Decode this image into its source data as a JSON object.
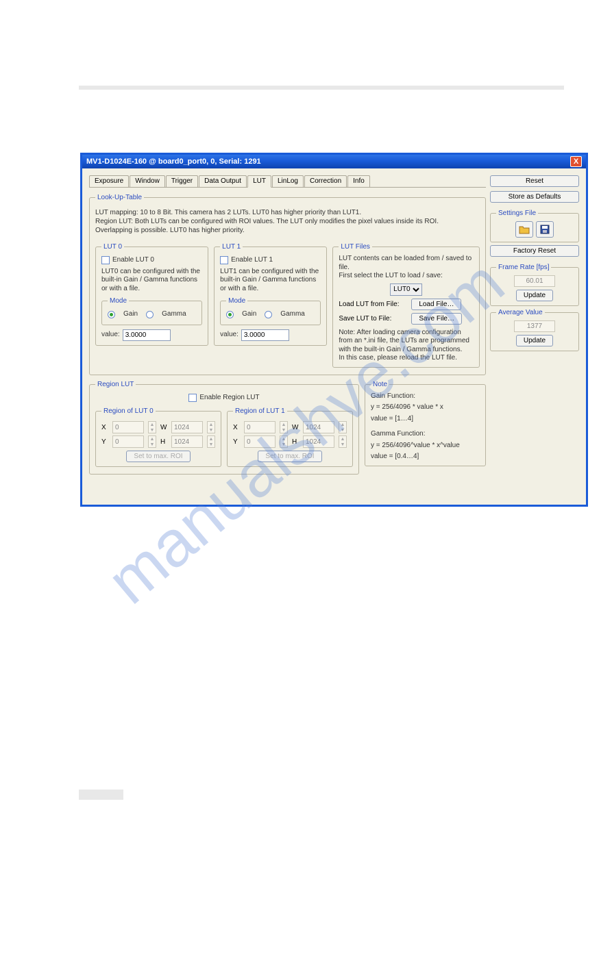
{
  "watermark": "manualshve.com",
  "window": {
    "title": "MV1-D1024E-160 @ board0_port0, 0, Serial: 1291",
    "close_icon": "X"
  },
  "tabs": [
    "Exposure",
    "Window",
    "Trigger",
    "Data Output",
    "LUT",
    "LinLog",
    "Correction",
    "Info"
  ],
  "active_tab_index": 4,
  "lookup": {
    "legend": "Look-Up-Table",
    "desc": "LUT mapping: 10 to 8 Bit. This camera has 2 LUTs. LUT0 has higher priority than LUT1.\nRegion LUT: Both LUTs can be configured with ROI values. The LUT only modifies the pixel values inside its ROI.\nOverlapping is possible. LUT0 has higher priority."
  },
  "lut0": {
    "legend": "LUT 0",
    "enable": "Enable LUT 0",
    "desc": "LUT0 can be configured with the built-in Gain / Gamma functions or with a file.",
    "mode_legend": "Mode",
    "gain": "Gain",
    "gamma": "Gamma",
    "value_label": "value:",
    "value": "3.0000"
  },
  "lut1": {
    "legend": "LUT 1",
    "enable": "Enable LUT 1",
    "desc": "LUT1 can be configured with the built-in Gain / Gamma functions or with a file.",
    "mode_legend": "Mode",
    "gain": "Gain",
    "gamma": "Gamma",
    "value_label": "value:",
    "value": "3.0000"
  },
  "lutfiles": {
    "legend": "LUT Files",
    "desc": "LUT contents can be loaded from / saved to file.\nFirst select the LUT to load / save:",
    "select_val": "LUT0",
    "load_label": "Load LUT from File:",
    "load_btn": "Load File…",
    "save_label": "Save LUT to File:",
    "save_btn": "Save File…",
    "note": "Note: After loading camera configuration from an *.ini file, the LUTs are programmed with the built-in Gain / Gamma functions.\nIn this case, please reload the LUT file."
  },
  "regionlut": {
    "legend": "Region LUT",
    "enable": "Enable Region LUT",
    "r0_legend": "Region of LUT 0",
    "r1_legend": "Region of LUT 1",
    "X": "X",
    "Y": "Y",
    "W": "W",
    "H": "H",
    "x0": "0",
    "y0": "0",
    "w0": "1024",
    "h0": "1024",
    "x1": "0",
    "y1": "0",
    "w1": "1024",
    "h1": "1024",
    "setmax": "Set to max. ROI"
  },
  "note_block": {
    "legend": "Note",
    "l1": "Gain Function:",
    "l2": "y = 256/4096 * value * x",
    "l3": "value = [1…4]",
    "l4": "Gamma Function:",
    "l5": "y = 256/4096^value * x^value",
    "l6": "value = [0.4…4]"
  },
  "side": {
    "reset": "Reset",
    "store": "Store as Defaults",
    "settings_legend": "Settings File",
    "open_icon": "open-folder-icon",
    "save_icon": "floppy-icon",
    "factory": "Factory Reset",
    "framerate_legend": "Frame Rate [fps]",
    "framerate_val": "60.01",
    "update1": "Update",
    "avg_legend": "Average Value",
    "avg_val": "1377",
    "update2": "Update"
  }
}
